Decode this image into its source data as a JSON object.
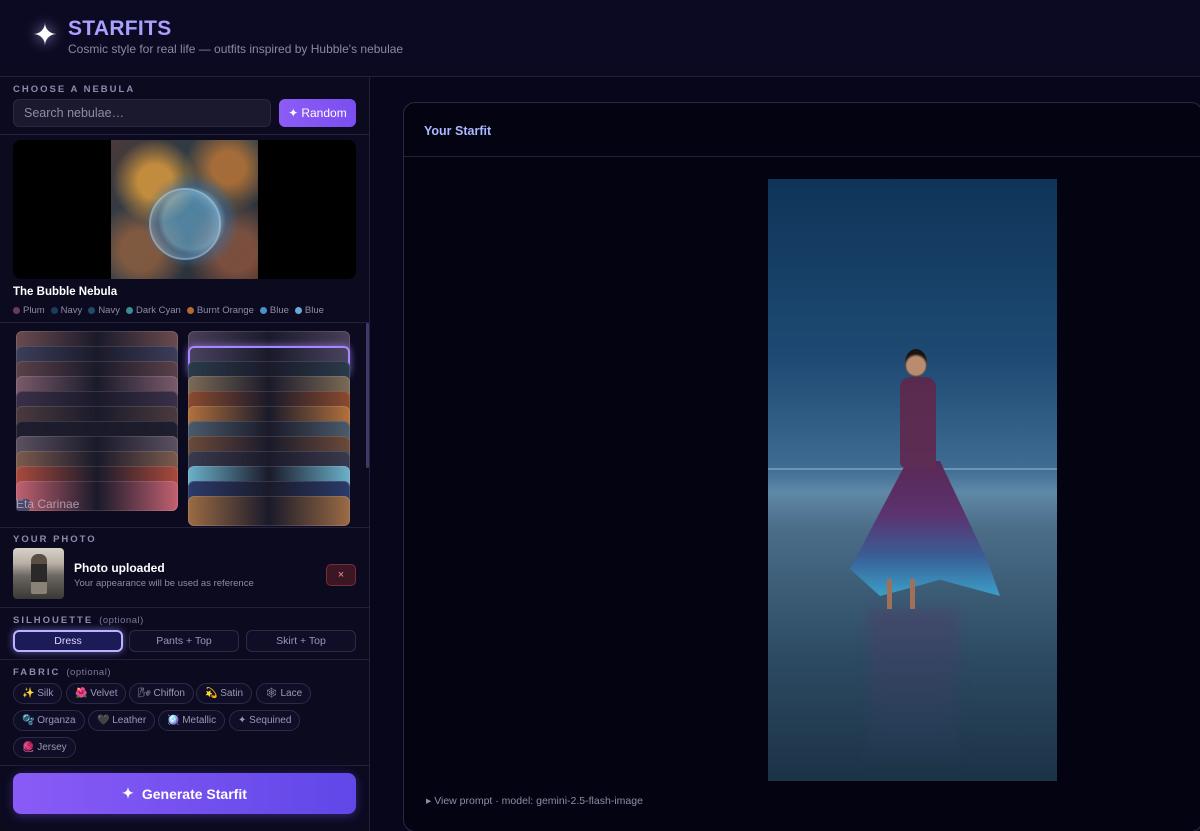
{
  "header": {
    "logo_glyph": "✦",
    "title": "STARFITS",
    "tagline": "Cosmic style for real life — outfits inspired by Hubble's nebulae"
  },
  "sidebar": {
    "choose_label": "CHOOSE A NEBULA",
    "search": {
      "placeholder": "Search nebulae…",
      "value": ""
    },
    "random_button": {
      "icon": "✦",
      "label": "Random"
    },
    "selected_nebula": {
      "name": "The Bubble Nebula",
      "palette": [
        {
          "name": "Plum",
          "color": "#6b3a5e"
        },
        {
          "name": "Navy",
          "color": "#1d3b5c"
        },
        {
          "name": "Navy",
          "color": "#214a6b"
        },
        {
          "name": "Dark Cyan",
          "color": "#3b8a96"
        },
        {
          "name": "Burnt Orange",
          "color": "#b06a34"
        },
        {
          "name": "Blue",
          "color": "#4a8fcf"
        },
        {
          "name": "Blue",
          "color": "#6aa8d8"
        }
      ]
    },
    "gallery": {
      "caption": "Eta Carinae",
      "left_column_colors": [
        "#6a4a4e",
        "#3c3e5a",
        "#5a4048",
        "#7a5a6a",
        "#3a3048",
        "#4a3a3e",
        "#1e1e2e",
        "#5a5060",
        "#7a5a4e",
        "#a84a3c",
        "#c06070"
      ],
      "right_column_colors": [
        "#4a3e58",
        "#4a4260",
        "#2a3a4a",
        "#7a6a56",
        "#8a4a2e",
        "#b0703c",
        "#4a5a6a",
        "#6a4a3a",
        "#3a3a4e",
        "#6ab0c8",
        "#2a3a6a",
        "#9a6a44"
      ]
    },
    "photo": {
      "label": "YOUR PHOTO",
      "title": "Photo uploaded",
      "subtitle": "Your appearance will be used as reference",
      "remove_label": "×"
    },
    "silhouette": {
      "label": "SILHOUETTE",
      "optional": "(optional)",
      "options": [
        "Dress",
        "Pants + Top",
        "Skirt + Top"
      ],
      "selected": "Dress"
    },
    "fabric": {
      "label": "FABRIC",
      "optional": "(optional)",
      "options": [
        "✨ Silk",
        "🌺 Velvet",
        "🌬 Chiffon",
        "💫 Satin",
        "🕸 Lace",
        "🫧 Organza",
        "🖤 Leather",
        "🪩 Metallic",
        "✦ Sequined",
        "🧶 Jersey"
      ]
    },
    "generate_button": {
      "icon": "✦",
      "label": "Generate Starfit"
    }
  },
  "main": {
    "panel_title": "Your Starfit",
    "view_prompt": "▸ View prompt · model: gemini-2.5-flash-image"
  },
  "colors": {
    "background": "#07061a",
    "accent": "#8c5cf5",
    "title": "#a9a0ff"
  }
}
